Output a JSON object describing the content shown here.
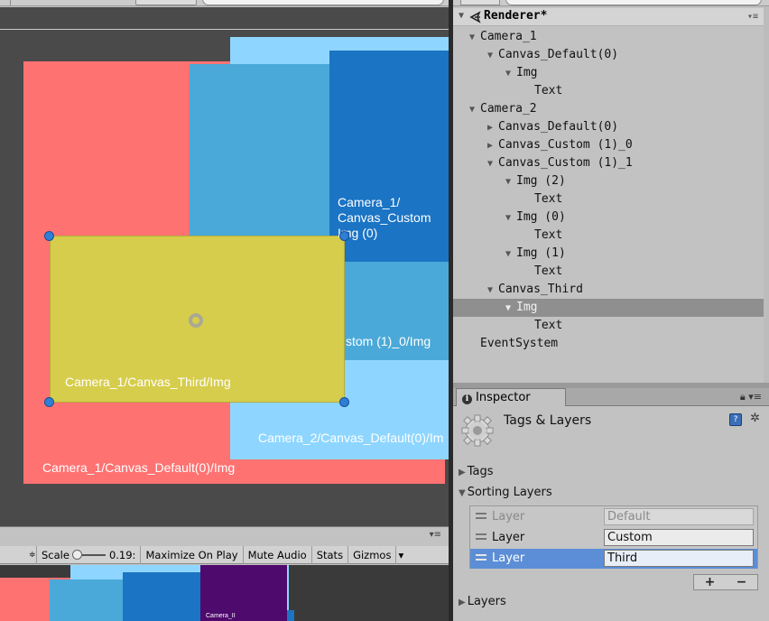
{
  "scene": {
    "labels": {
      "cam1_custom_img0": [
        "Camera_1/",
        "Canvas_Custom",
        "Img (0)"
      ],
      "custom_1_0_img": "stom (1)_0/Img",
      "third_img": "Camera_1/Canvas_Third/Img",
      "cam2_default_img": "Camera_2/Canvas_Default(0)/Im",
      "cam1_default_img": "Camera_1/Canvas_Default(0)/Img"
    }
  },
  "game": {
    "toolbar": {
      "scale_label": "Scale",
      "scale_value": "0.19:",
      "scale_fraction": 0.05,
      "maximize_on_play": "Maximize On Play",
      "mute_audio": "Mute Audio",
      "stats": "Stats",
      "gizmos": "Gizmos"
    },
    "canvas_text": "Camera_II"
  },
  "hierarchy": {
    "scene_name": "Renderer*",
    "items": [
      {
        "label": "Camera_1",
        "arrow": "▼",
        "depth": 1
      },
      {
        "label": "Canvas_Default(0)",
        "arrow": "▼",
        "depth": 2
      },
      {
        "label": "Img",
        "arrow": "▼",
        "depth": 3
      },
      {
        "label": "Text",
        "arrow": "",
        "depth": 4
      },
      {
        "label": "Camera_2",
        "arrow": "▼",
        "depth": 1
      },
      {
        "label": "Canvas_Default(0)",
        "arrow": "▶",
        "depth": 2
      },
      {
        "label": "Canvas_Custom (1)_0",
        "arrow": "▶",
        "depth": 2
      },
      {
        "label": "Canvas_Custom (1)_1",
        "arrow": "▼",
        "depth": 2
      },
      {
        "label": "Img (2)",
        "arrow": "▼",
        "depth": 3
      },
      {
        "label": "Text",
        "arrow": "",
        "depth": 4
      },
      {
        "label": "Img (0)",
        "arrow": "▼",
        "depth": 3
      },
      {
        "label": "Text",
        "arrow": "",
        "depth": 4
      },
      {
        "label": "Img (1)",
        "arrow": "▼",
        "depth": 3
      },
      {
        "label": "Text",
        "arrow": "",
        "depth": 4
      },
      {
        "label": "Canvas_Third",
        "arrow": "▼",
        "depth": 2
      },
      {
        "label": "Img",
        "arrow": "▼",
        "depth": 3,
        "selected": true
      },
      {
        "label": "Text",
        "arrow": "",
        "depth": 4
      },
      {
        "label": "EventSystem",
        "arrow": "",
        "depth": 1
      }
    ]
  },
  "inspector": {
    "tab_label": "Inspector",
    "title": "Tags & Layers",
    "sections": {
      "tags": "Tags",
      "sorting_layers": "Sorting Layers",
      "layers": "Layers"
    },
    "sorting_layers": [
      {
        "name": "Layer",
        "value": "Default",
        "dim": true
      },
      {
        "name": "Layer",
        "value": "Custom"
      },
      {
        "name": "Layer",
        "value": "Third",
        "selected": true
      }
    ],
    "add_label": "+",
    "remove_label": "−"
  },
  "colors": {
    "salmon": "#ff7272",
    "light_blue": "#8ed6ff",
    "mid_blue": "#4aa9d8",
    "dark_blue": "#1b74c4",
    "yellow": "#d6cd4c",
    "purple": "#4e0a6c",
    "selection": "#5b8ed6"
  }
}
